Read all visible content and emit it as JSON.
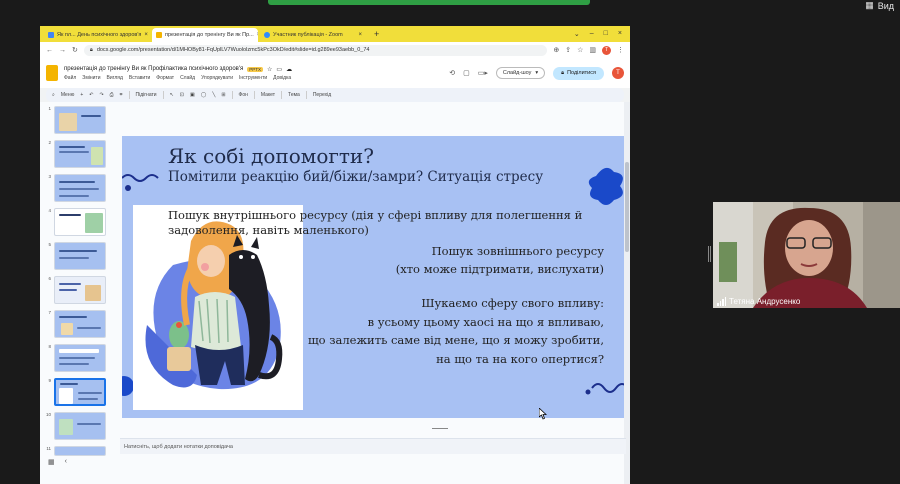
{
  "zoom": {
    "view_label": "Вид"
  },
  "browser": {
    "tabs": [
      {
        "title": "Як пл... День психічного здоров'я",
        "active": false,
        "favicon_color": "#4285f4"
      },
      {
        "title": "презентація до тренінгу Ви як Пр...",
        "active": true,
        "favicon_color": "#f4b400"
      },
      {
        "title": "Участник публікація - Zoom",
        "active": false,
        "favicon_color": "#2d8cff"
      }
    ],
    "url": "docs.google.com/presentation/d/1MHOBy81-FqUplLV7Wuololzmc5kPc3OkD/edit#slide=id.g289ee93aebb_0_74"
  },
  "doc": {
    "title": "презентація до тренінгу Ви як Профілактика психічного здоров'я",
    "badge": "PPTX",
    "menu": [
      "Файл",
      "Змінити",
      "Вигляд",
      "Вставити",
      "Формат",
      "Слайд",
      "Упорядкувати",
      "Інструменти",
      "Довідка"
    ],
    "slideshow_label": "Слайд-шоу",
    "share_label": "Поділитися",
    "avatar_letter": "Т"
  },
  "toolbar": {
    "search_label": "Меню",
    "fit_label": "Підігнати",
    "items": [
      "Фон",
      "Макет",
      "Тема",
      "Перехід"
    ]
  },
  "filmstrip": {
    "numbers": [
      "1",
      "2",
      "3",
      "4",
      "5",
      "6",
      "7",
      "8",
      "9",
      "10",
      "11"
    ],
    "selected_index": 8
  },
  "slide": {
    "title": "Як собі допомогти?",
    "subtitle": "Помітили реакцію бий/біжи/замри? Ситуація стресу",
    "inner_line1": "Пошук внутрішнього ресурсу (дія у сфері впливу для полегшення й",
    "inner_line2": "задоволення, навіть маленького)",
    "outer_line1": "Пошук зовнішнього ресурсу",
    "outer_line2": "(хто може підтримати, вислухати)",
    "sphere_line1": "Шукаємо сферу свого впливу:",
    "sphere_line2": "в усьому цьому хаосі на що я впливаю,",
    "sphere_line3": "що залежить саме від мене, що я можу зробити,",
    "sphere_line4": "на що та на кого опертися?"
  },
  "notes": {
    "placeholder": "Натисніть, щоб додати нотатки доповідача"
  },
  "participant": {
    "name": "Тетяна Андрусенко"
  }
}
